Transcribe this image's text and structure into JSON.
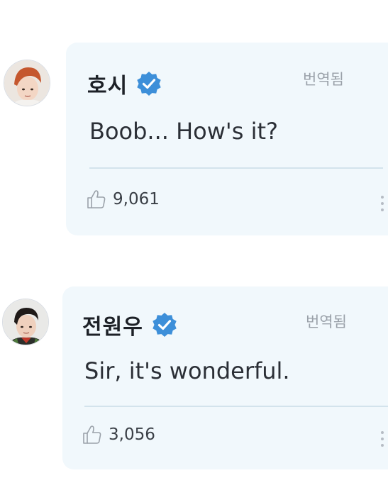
{
  "comments": [
    {
      "author": "호시",
      "verified": true,
      "translated_label": "번역됨",
      "text": "Boob... How's it?",
      "likes": "9,061"
    },
    {
      "author": "전원우",
      "verified": true,
      "translated_label": "번역됨",
      "text": "Sir, it's wonderful.",
      "likes": "3,056"
    }
  ],
  "colors": {
    "card_background": "#f1f8fc",
    "verified_badge": "#3d8fd9",
    "divider": "#d3e3ec",
    "muted_text": "#9aa1a9"
  },
  "icons": {
    "verified": "verified-badge-icon",
    "like": "thumbs-up-icon",
    "more": "more-options-icon"
  }
}
